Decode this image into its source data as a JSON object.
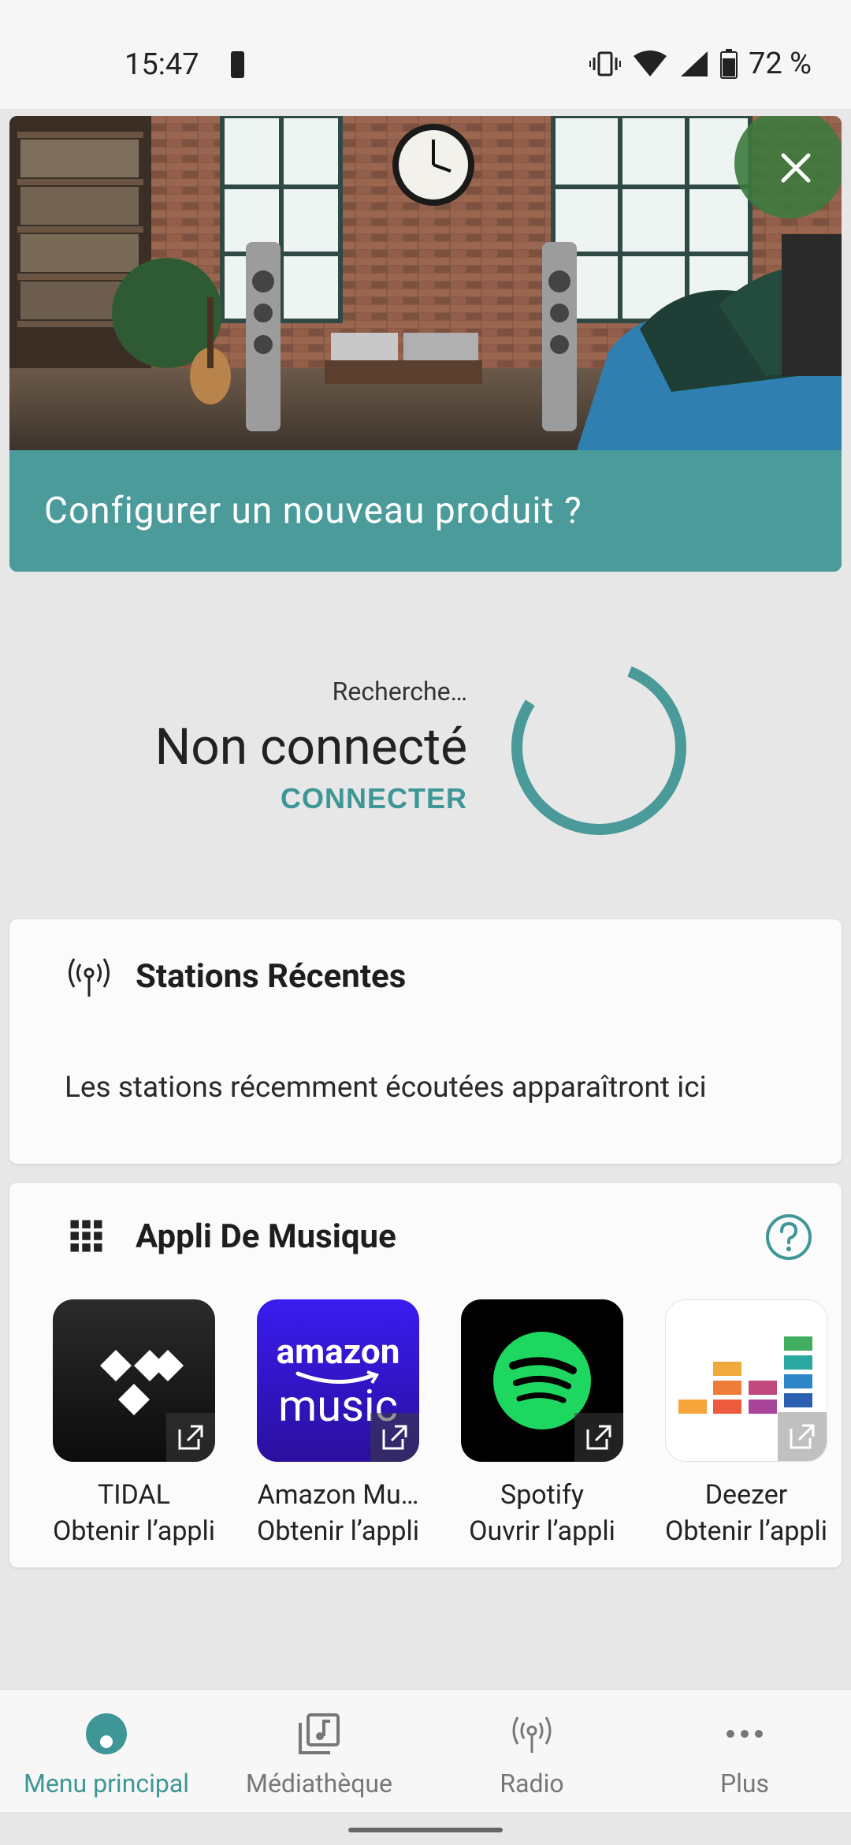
{
  "status_bar": {
    "time": "15:47",
    "battery_percent": "72 %",
    "icons": [
      "battery-icon",
      "vibrate-icon",
      "wifi-icon",
      "signal-icon",
      "battery-icon"
    ]
  },
  "hero": {
    "title": "Configurer un nouveau produit ?",
    "close_icon": "close-icon"
  },
  "connection": {
    "searching": "Recherche…",
    "status": "Non connecté",
    "connect_label": "CONNECTER",
    "spinner_color": "#4a9a9a"
  },
  "recent_stations": {
    "title": "Stations Récentes",
    "icon": "radio-antenna-icon",
    "empty_message": "Les stations récemment écoutées apparaîtront ici"
  },
  "music_apps": {
    "title": "Appli De Musique",
    "icon": "grid-icon",
    "help_icon": "help-icon",
    "apps": [
      {
        "name": "TIDAL",
        "action": "Obtenir l’appli",
        "icon": "tidal-logo"
      },
      {
        "name": "Amazon Mu…",
        "action": "Obtenir l’appli",
        "icon": "amazon-music-logo",
        "logo_top": "amazon",
        "logo_bottom": "music"
      },
      {
        "name": "Spotify",
        "action": "Ouvrir l’appli",
        "icon": "spotify-logo"
      },
      {
        "name": "Deezer",
        "action": "Obtenir l’appli",
        "icon": "deezer-logo"
      }
    ]
  },
  "bottom_nav": {
    "items": [
      {
        "label": "Menu principal",
        "icon": "home-dot-icon",
        "active": true
      },
      {
        "label": "Médiathèque",
        "icon": "music-library-icon",
        "active": false
      },
      {
        "label": "Radio",
        "icon": "radio-antenna-icon",
        "active": false
      },
      {
        "label": "Plus",
        "icon": "more-dots-icon",
        "active": false
      }
    ]
  },
  "colors": {
    "accent": "#3f9696",
    "banner": "#4b9b9b",
    "background": "#e7e7e7"
  }
}
